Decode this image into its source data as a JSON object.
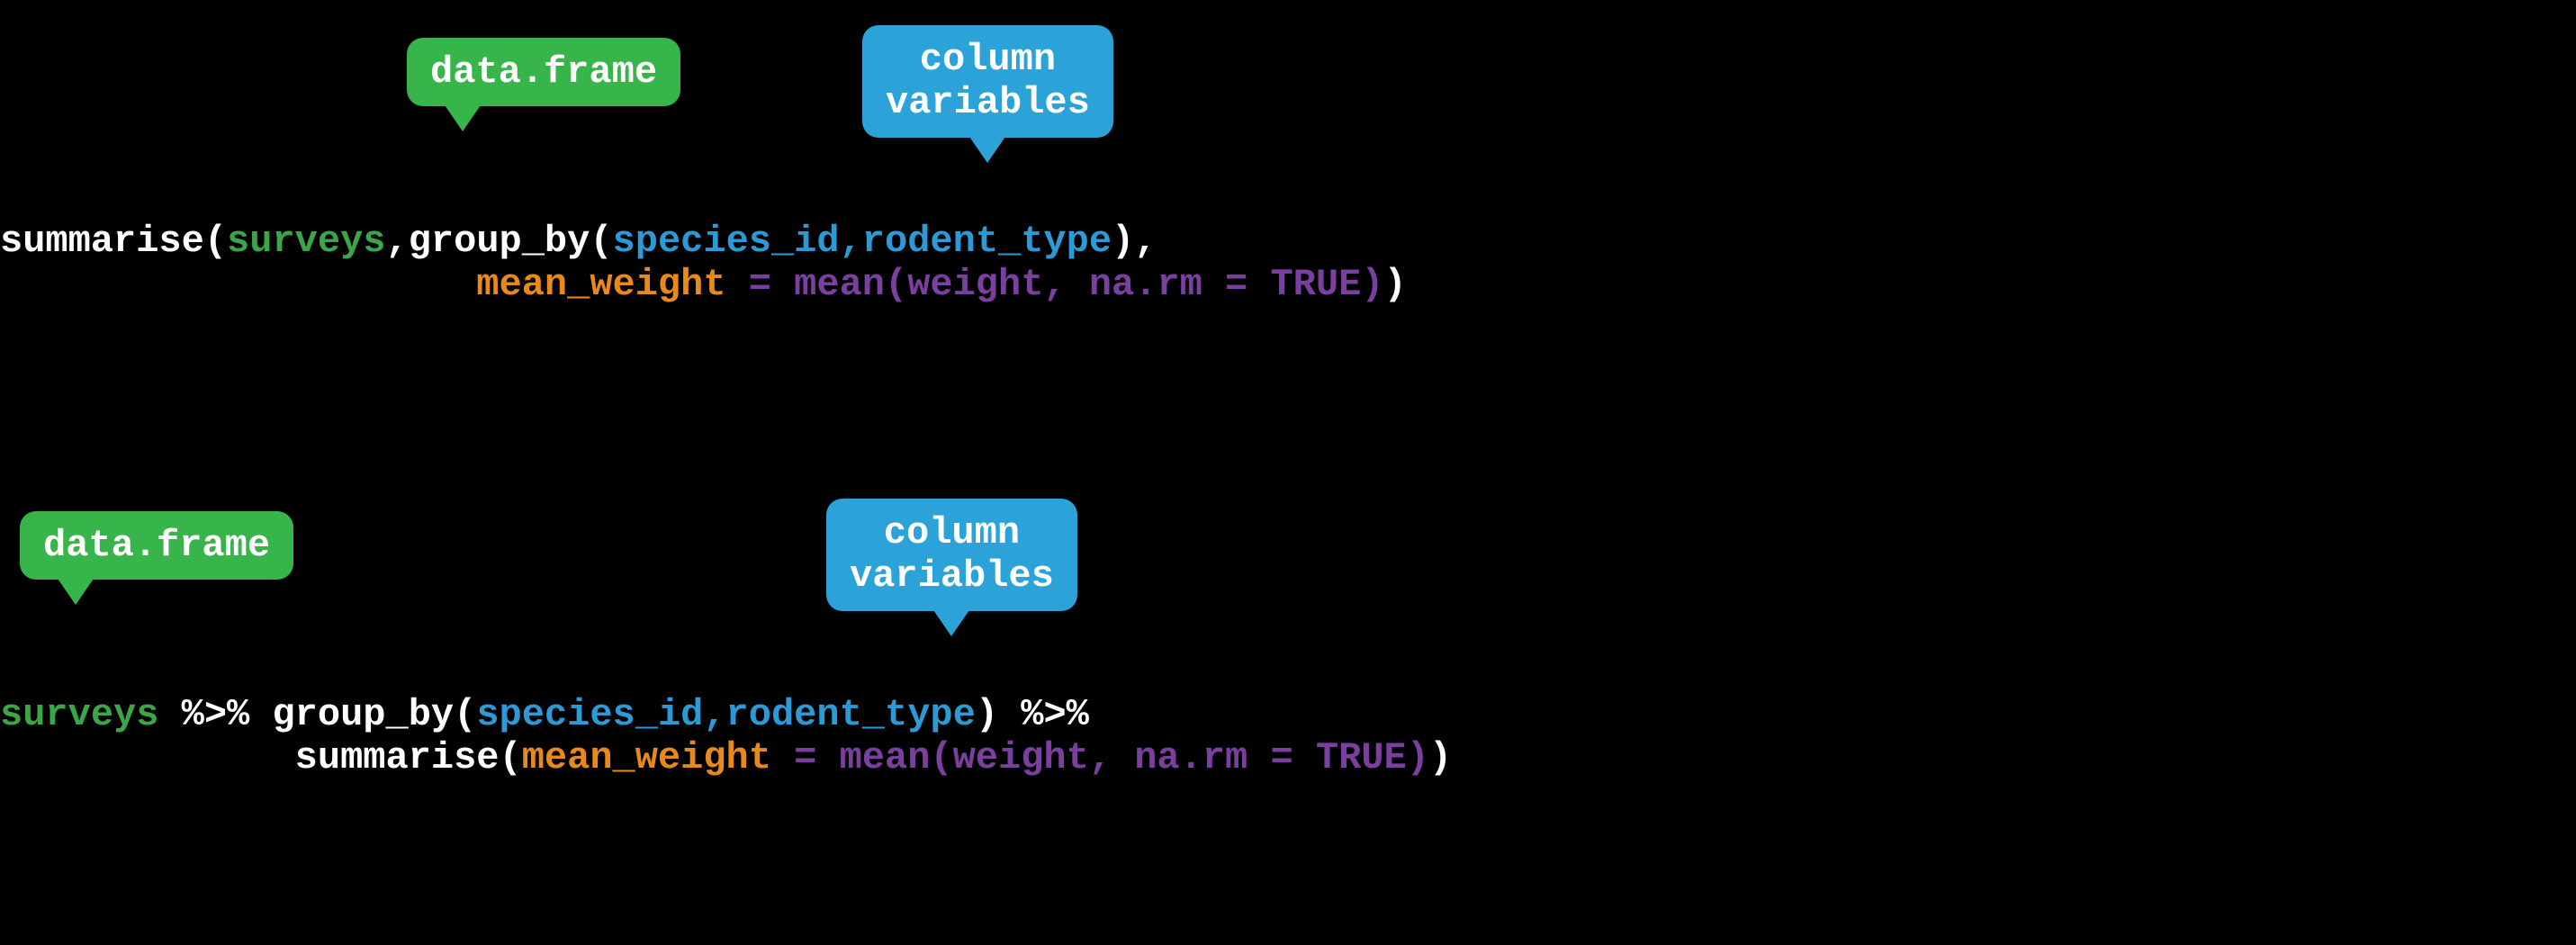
{
  "bubbles": {
    "dataframe1": "data.frame",
    "columns1_line1": "column",
    "columns1_line2": "variables",
    "dataframe2": "data.frame",
    "columns2_line1": "column",
    "columns2_line2": "variables"
  },
  "block1": {
    "line1": {
      "func": "summarise(",
      "dataframe": "surveys",
      "sep1": ",",
      "groupby": "group_by(",
      "cols": "species_id,rodent_type",
      "close1": ")",
      "trail": ","
    },
    "line2": {
      "newcol": "mean_weight",
      "assign": " = ",
      "expr": "mean(weight, na.rm = TRUE)",
      "close": ")"
    }
  },
  "block2": {
    "line1": {
      "dataframe": "surveys",
      "pipe": " %>% ",
      "groupby": "group_by(",
      "cols": "species_id,rodent_type",
      "close": ")",
      "pipe2": " %>%"
    },
    "line2": {
      "func": "summarise(",
      "newcol": "mean_weight",
      "assign": " = ",
      "expr": "mean(weight, na.rm = TRUE)",
      "close": ")"
    }
  }
}
